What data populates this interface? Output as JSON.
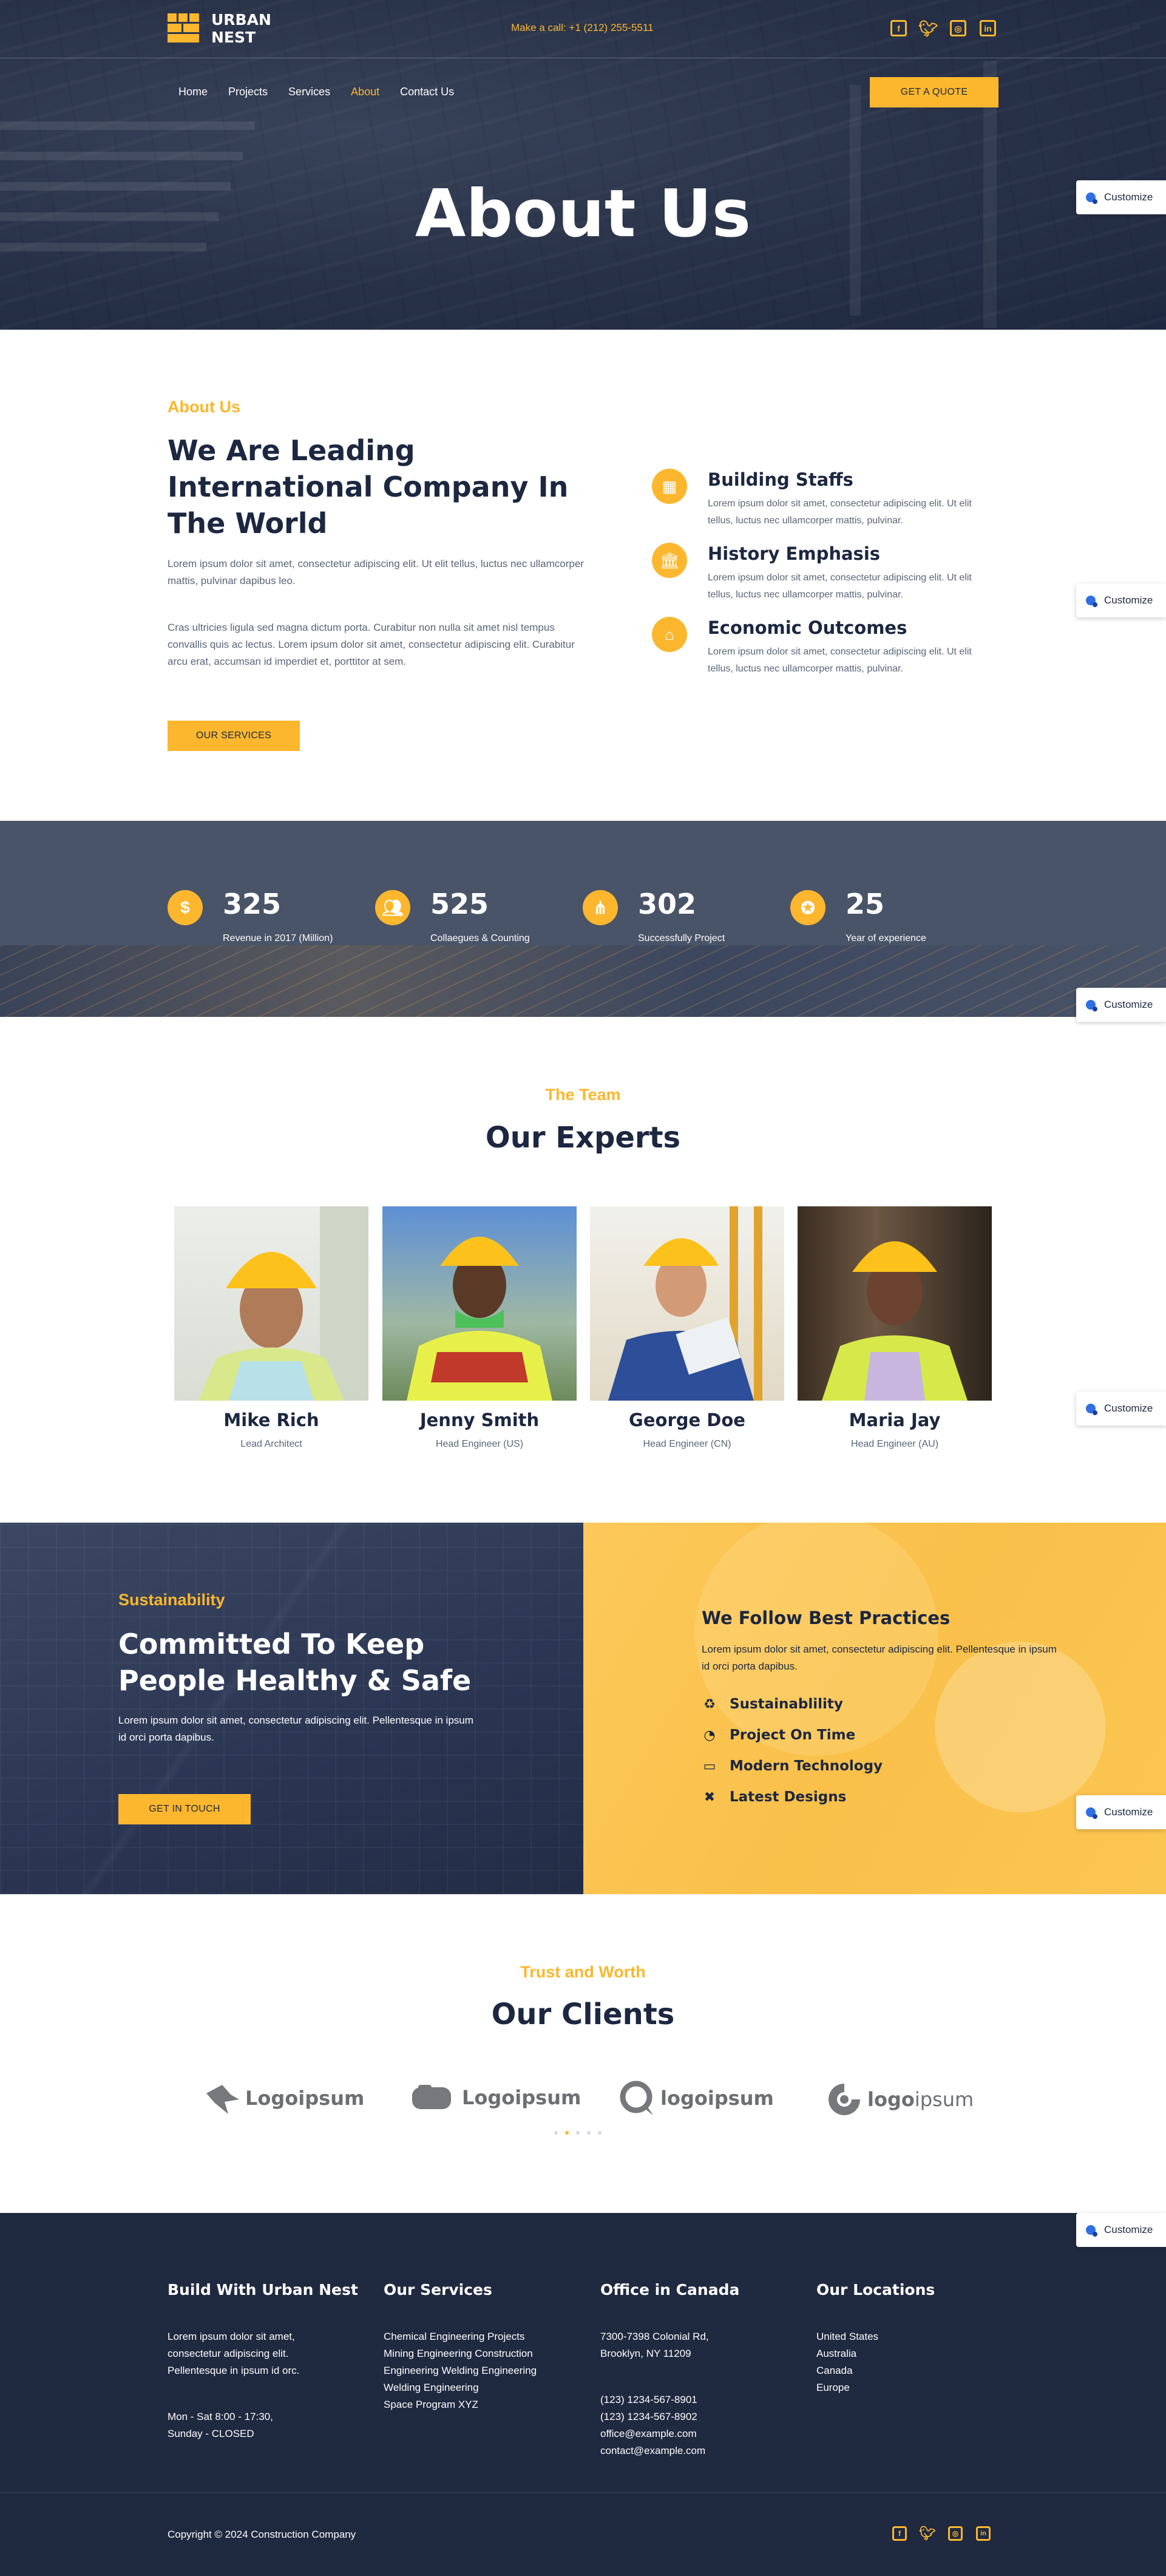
{
  "brand": {
    "line1": "URBAN",
    "line2": "NEST",
    "accent": "#fcb72e",
    "dark": "#1c2740"
  },
  "header": {
    "call": "Make a call: +1 (212) 255-5511",
    "social": [
      "facebook-icon",
      "twitter-icon",
      "instagram-icon",
      "linkedin-icon"
    ],
    "nav": [
      "Home",
      "Projects",
      "Services",
      "About",
      "Contact Us"
    ],
    "active_nav": "About",
    "quote_btn": "GET A QUOTE"
  },
  "hero": {
    "title": "About Us"
  },
  "customize_label": "Customize",
  "about": {
    "eyebrow": "About Us",
    "title": "We Are Leading International Company In The World",
    "p1": "Lorem ipsum dolor sit amet, consectetur adipiscing elit. Ut elit tellus, luctus nec ullamcorper mattis, pulvinar dapibus leo.",
    "p2": "Cras ultricies ligula sed magna dictum porta. Curabitur non nulla sit amet nisl tempus convallis quis ac lectus. Lorem ipsum dolor sit amet, consectetur adipiscing elit. Curabitur arcu erat, accumsan id imperdiet et, porttitor at sem.",
    "btn": "OUR SERVICES",
    "features": [
      {
        "title": "Building Staffs",
        "text": "Lorem ipsum dolor sit amet, consectetur adipiscing elit. Ut elit tellus, luctus nec ullamcorper mattis, pulvinar.",
        "icon": "building-icon"
      },
      {
        "title": "History Emphasis",
        "text": "Lorem ipsum dolor sit amet, consectetur adipiscing elit. Ut elit tellus, luctus nec ullamcorper mattis, pulvinar.",
        "icon": "landmark-icon"
      },
      {
        "title": "Economic Outcomes",
        "text": "Lorem ipsum dolor sit amet, consectetur adipiscing elit. Ut elit tellus, luctus nec ullamcorper mattis, pulvinar.",
        "icon": "house-user-icon"
      }
    ]
  },
  "stats": [
    {
      "num": "325",
      "label": "Revenue in 2017 (Million)",
      "icon": "dollar-icon"
    },
    {
      "num": "525",
      "label": "Collaegues & Counting",
      "icon": "users-icon"
    },
    {
      "num": "302",
      "label": "Successfully Project",
      "icon": "network-icon"
    },
    {
      "num": "25",
      "label": "Year of experience",
      "icon": "award-icon"
    }
  ],
  "team": {
    "eyebrow": "The Team",
    "title": "Our Experts",
    "members": [
      {
        "name": "Mike Rich",
        "role": "Lead Architect"
      },
      {
        "name": "Jenny Smith",
        "role": "Head Engineer (US)"
      },
      {
        "name": "George Doe",
        "role": "Head Engineer (CN)"
      },
      {
        "name": "Maria Jay",
        "role": "Head Engineer (AU)"
      }
    ]
  },
  "sustain": {
    "eyebrow": "Sustainability",
    "title": "Committed To Keep People Healthy & Safe",
    "text": "Lorem ipsum dolor sit amet, consectetur adipiscing elit. Pellentesque in ipsum id orci porta dapibus.",
    "btn": "GET IN TOUCH",
    "practices_title": "We Follow Best Practices",
    "practices_text": "Lorem ipsum dolor sit amet, consectetur adipiscing elit. Pellentesque in ipsum id orci porta dapibus.",
    "list": [
      {
        "label": "Sustainablility",
        "icon": "recycle-icon"
      },
      {
        "label": "Project On Time",
        "icon": "clock-icon"
      },
      {
        "label": "Modern Technology",
        "icon": "desktop-icon"
      },
      {
        "label": "Latest Designs",
        "icon": "tools-icon"
      }
    ]
  },
  "clients": {
    "eyebrow": "Trust and Worth",
    "title": "Our Clients",
    "logos": [
      {
        "prefix": "",
        "bold": "Logoipsum",
        "rest": ""
      },
      {
        "prefix": "",
        "bold": "Logoipsum",
        "rest": ""
      },
      {
        "prefix": "",
        "bold": "logoipsum",
        "rest": ""
      },
      {
        "prefix": "",
        "bold": "logo",
        "rest": "ipsum"
      }
    ]
  },
  "footer": {
    "col1": {
      "title": "Build With Urban Nest",
      "text": "Lorem ipsum dolor sit amet, consectetur adipiscing elit. Pellentesque in ipsum id orc.",
      "hours1": "Mon - Sat 8:00 - 17:30,",
      "hours2": "Sunday - CLOSED"
    },
    "col2": {
      "title": "Our Services",
      "items": [
        "Chemical Engineering Projects",
        "Mining Engineering Construction",
        "Engineering Welding Engineering",
        "Welding Engineering",
        "Space Program XYZ"
      ]
    },
    "col3": {
      "title": "Office in Canada",
      "addr1": "7300-7398 Colonial Rd,",
      "addr2": "Brooklyn, NY 11209",
      "contacts": [
        "(123) 1234-567-8901",
        "(123) 1234-567-8902",
        "office@example.com",
        "contact@example.com"
      ]
    },
    "col4": {
      "title": "Our Locations",
      "items": [
        "United States",
        "Australia",
        "Canada",
        "Europe"
      ]
    },
    "copyright": "Copyright © 2024 Construction Company"
  }
}
